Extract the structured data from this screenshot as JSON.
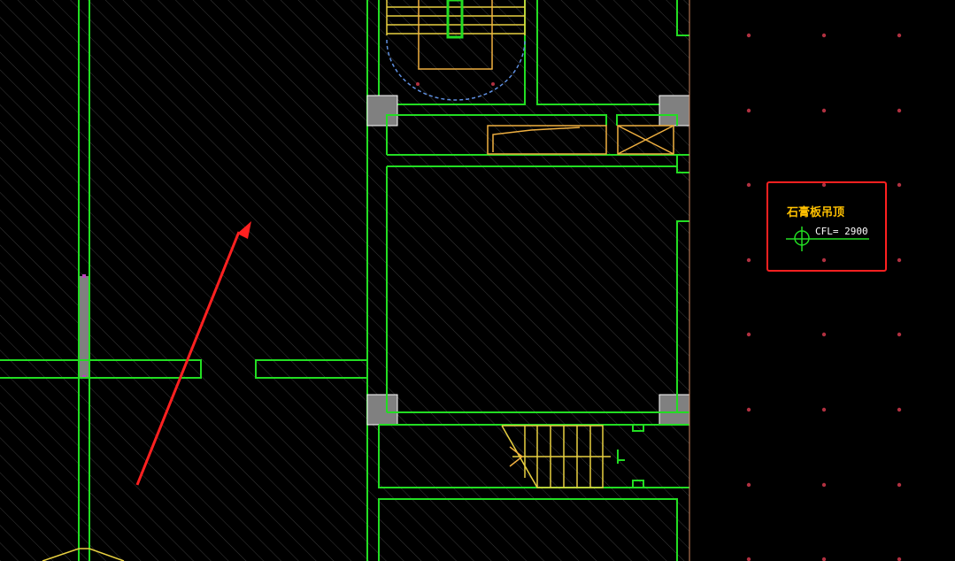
{
  "colors": {
    "background": "#000000",
    "hatch": "#3a3a3a",
    "wall": "#22dd22",
    "furniture": "#f0b040",
    "stair": "#e8d040",
    "arc": "#5f8fe0",
    "column_fill": "#808080",
    "annotation_red": "#ff2020",
    "label_yellow": "#ffc000",
    "label_white": "#ffffff",
    "grid_dot": "#b03040",
    "magenta": "#c040c0"
  },
  "annotation": {
    "title": "石膏板吊顶",
    "level": "CFL= 2900"
  },
  "icons": {
    "level_marker": "crosshair-circle-icon",
    "pointer": "red-arrow-icon"
  }
}
